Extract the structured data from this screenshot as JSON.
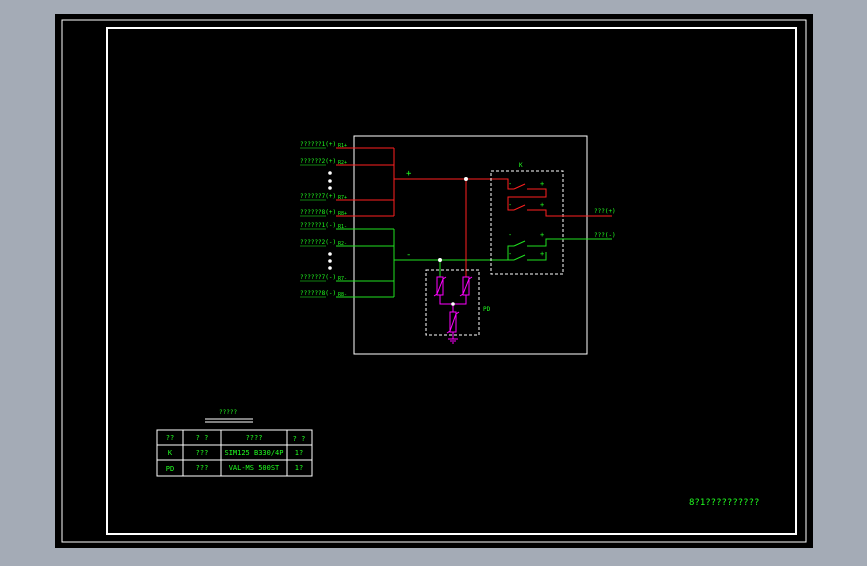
{
  "drawing": {
    "colors": {
      "background": "#a4abb6",
      "paper": "#000000",
      "border": "#ffffff",
      "positive": "#ff2020",
      "negative": "#20e020",
      "spd": "#ff00ff",
      "label": "#20ff20",
      "box": "#ffffff"
    },
    "inputs_positive": [
      {
        "name": "??????1(+)",
        "tag": "R1+"
      },
      {
        "name": "??????2(+)",
        "tag": "R2+"
      },
      {
        "name": "??????7(+)",
        "tag": "R7+"
      },
      {
        "name": "??????8(+)",
        "tag": "R8+"
      }
    ],
    "inputs_negative": [
      {
        "name": "??????1(-)",
        "tag": "R1-"
      },
      {
        "name": "??????2(-)",
        "tag": "R2-"
      },
      {
        "name": "??????7(-)",
        "tag": "R7-"
      },
      {
        "name": "??????8(-)",
        "tag": "R8-"
      }
    ],
    "bus_plus": "+",
    "bus_minus": "-",
    "switch_label": "K",
    "spd_label": "PD",
    "output_positive": "???(+)",
    "output_negative": "???(-)",
    "contact_plus": "+",
    "contact_minus": "-"
  },
  "legend": {
    "title": "?????",
    "headers": [
      "??",
      "? ?",
      "????",
      "? ?"
    ],
    "rows": [
      [
        "K",
        "???",
        "SIM125 B330/4P",
        "1?"
      ],
      [
        "PD",
        "???",
        "VAL-MS 500ST",
        "1?"
      ]
    ]
  },
  "footer": {
    "title": "8?1??????????"
  }
}
